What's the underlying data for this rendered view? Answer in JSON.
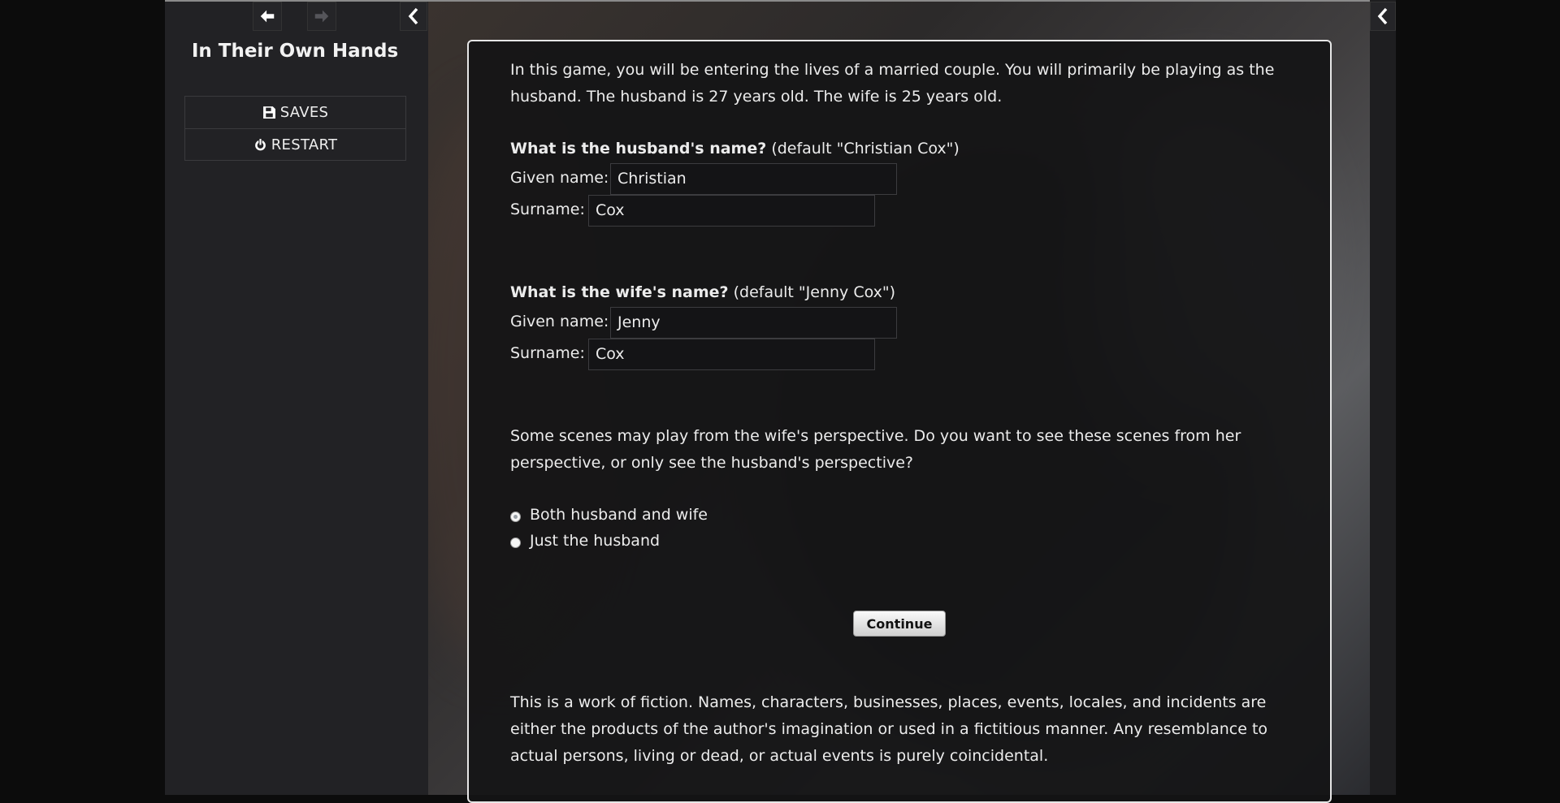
{
  "sidebar": {
    "title": "In Their Own Hands",
    "menu": [
      {
        "label": "SAVES",
        "icon": "save-icon"
      },
      {
        "label": "RESTART",
        "icon": "power-icon"
      }
    ]
  },
  "passage": {
    "intro": "In this game, you will be entering the lives of a married couple. You will primarily be playing as the husband. The husband is 27 years old. The wife is 25 years old.",
    "husband": {
      "question": "What is the husband's name?",
      "default_note": "(default \"Christian Cox\")",
      "given_label": "Given name:",
      "given_value": "Christian",
      "surname_label": "Surname:",
      "surname_value": "Cox"
    },
    "wife": {
      "question": "What is the wife's name?",
      "default_note": "(default \"Jenny Cox\")",
      "given_label": "Given name:",
      "given_value": "Jenny",
      "surname_label": "Surname:",
      "surname_value": "Cox"
    },
    "perspective_text": "Some scenes may play from the wife's perspective. Do you want to see these scenes from her perspective, or only see the husband's perspective?",
    "options": [
      {
        "label": "Both husband and wife",
        "selected": true
      },
      {
        "label": "Just the husband",
        "selected": false
      }
    ],
    "continue_label": "Continue",
    "disclaimer": "This is a work of fiction. Names, characters, businesses, places, events, locales, and incidents are either the products of the author's imagination or used in a fictitious manner. Any resemblance to actual persons, living or dead, or actual events is purely coincidental."
  },
  "colors": {
    "page_bg": "#0c0c0c",
    "sidebar_bg": "#222225",
    "passage_bg": "#141416",
    "text": "#ececec"
  }
}
